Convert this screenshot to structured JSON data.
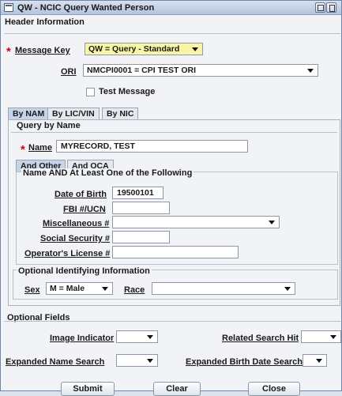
{
  "window": {
    "title": "QW - NCIC Query Wanted Person"
  },
  "header_section": {
    "title": "Header Information",
    "message_key": {
      "label": "Message Key",
      "value": "QW = Query - Standard"
    },
    "ori": {
      "label": "ORI",
      "value": "NMCPI0001 = CPI TEST ORI"
    },
    "test_message": {
      "label": "Test Message",
      "checked": false
    }
  },
  "tabs": [
    "By NAM",
    "By LIC/VIN",
    "By NIC"
  ],
  "query_by_name": {
    "title": "Query by Name",
    "name": {
      "label": "Name",
      "value": "MYRECORD, TEST"
    },
    "subtabs": [
      "And Other",
      "And OCA"
    ],
    "group_title": "Name AND At Least One of the Following",
    "dob": {
      "label": "Date of Birth",
      "value": "19500101"
    },
    "fbi": {
      "label": "FBI #/UCN",
      "value": ""
    },
    "misc": {
      "label": "Miscellaneous #",
      "value": ""
    },
    "ssn": {
      "label": "Social Security #",
      "value": ""
    },
    "oln": {
      "label": "Operator's License #",
      "value": ""
    },
    "optional_title": "Optional Identifying Information",
    "sex": {
      "label": "Sex",
      "value": "M = Male"
    },
    "race": {
      "label": "Race",
      "value": ""
    }
  },
  "optional_fields": {
    "title": "Optional Fields",
    "image_indicator": {
      "label": "Image Indicator",
      "value": ""
    },
    "related_search_hit": {
      "label": "Related Search Hit",
      "value": ""
    },
    "expanded_name_search": {
      "label": "Expanded Name Search",
      "value": ""
    },
    "expanded_dob_search": {
      "label": "Expanded Birth Date Search",
      "value": ""
    }
  },
  "buttons": {
    "submit": "Submit",
    "clear": "Clear",
    "close": "Close"
  },
  "colors": {
    "required_star": "#d6001c",
    "highlight_select": "#f8f5a6",
    "title_bar": "#b4c4dc"
  }
}
